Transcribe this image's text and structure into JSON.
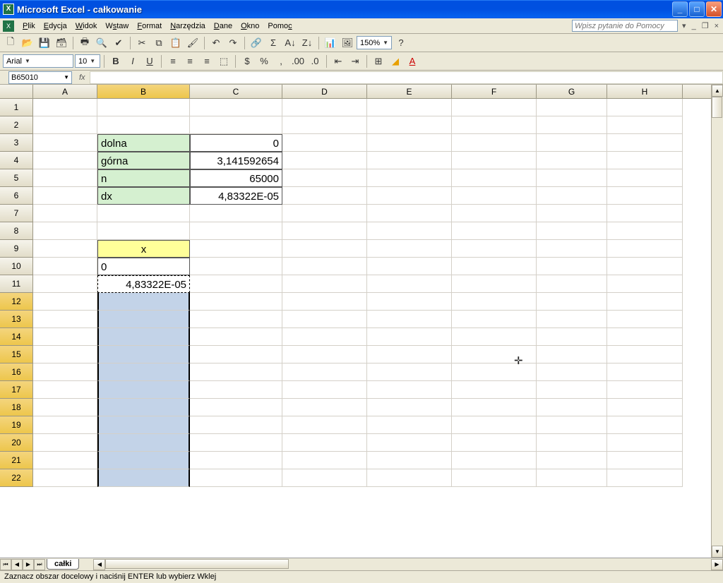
{
  "window": {
    "title": "Microsoft Excel - całkowanie"
  },
  "menu": {
    "items": [
      "Plik",
      "Edycja",
      "Widok",
      "Wstaw",
      "Format",
      "Narzędzia",
      "Dane",
      "Okno",
      "Pomoc"
    ],
    "help_placeholder": "Wpisz pytanie do Pomocy"
  },
  "format_toolbar": {
    "font": "Arial",
    "size": "10",
    "zoom": "150%"
  },
  "formula": {
    "name_box": "B65010",
    "fx": "fx"
  },
  "columns": [
    "A",
    "B",
    "C",
    "D",
    "E",
    "F",
    "G",
    "H"
  ],
  "rows": [
    1,
    2,
    3,
    4,
    5,
    6,
    7,
    8,
    9,
    10,
    11,
    12,
    13,
    14,
    15,
    16,
    17,
    18,
    19,
    20,
    21,
    22
  ],
  "cells": {
    "B3": "dolna",
    "C3": "0",
    "B4": "górna",
    "C4": "3,141592654",
    "B5": "n",
    "C5": "65000",
    "B6": "dx",
    "C6": "4,83322E-05",
    "B9": "x",
    "B10": "0",
    "B11": "4,83322E-05"
  },
  "sheet_tabs": {
    "active": "całki"
  },
  "status": "Zaznacz obszar docelowy i naciśnij ENTER lub wybierz Wklej"
}
